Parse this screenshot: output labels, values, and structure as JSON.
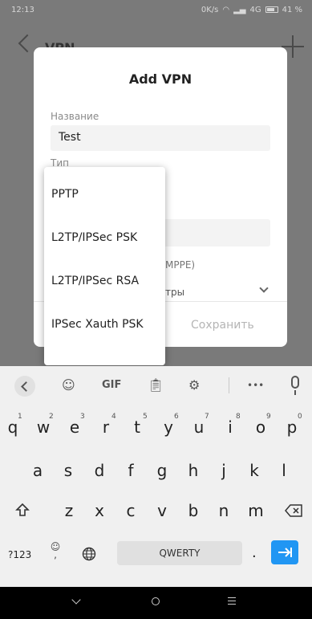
{
  "status_bar": {
    "time": "12:13",
    "speed": "0K/s",
    "network": "4G",
    "battery": "41 %"
  },
  "app_header": {
    "title": "VPN"
  },
  "dialog": {
    "title": "Add VPN",
    "name_label": "Название",
    "name_value": "Test",
    "type_label": "Тип",
    "encryption_partial": "MPPE)",
    "advanced_partial": "тры",
    "save_label": "Сохранить"
  },
  "type_menu": {
    "items": [
      "PPTP",
      "L2TP/IPSec PSK",
      "L2TP/IPSec RSA",
      "IPSec Xauth PSK"
    ]
  },
  "keyboard": {
    "toolbar": {
      "gif": "GIF",
      "more": "•••"
    },
    "row1": [
      "q",
      "w",
      "e",
      "r",
      "t",
      "y",
      "u",
      "i",
      "o",
      "p"
    ],
    "row1_hints": [
      "1",
      "2",
      "3",
      "4",
      "5",
      "6",
      "7",
      "8",
      "9",
      "0"
    ],
    "row2": [
      "a",
      "s",
      "d",
      "f",
      "g",
      "h",
      "j",
      "k",
      "l"
    ],
    "row3": [
      "z",
      "x",
      "c",
      "v",
      "b",
      "n",
      "m"
    ],
    "symbols_label": "?123",
    "comma": ",",
    "space_label": "QWERTY",
    "period": "."
  }
}
